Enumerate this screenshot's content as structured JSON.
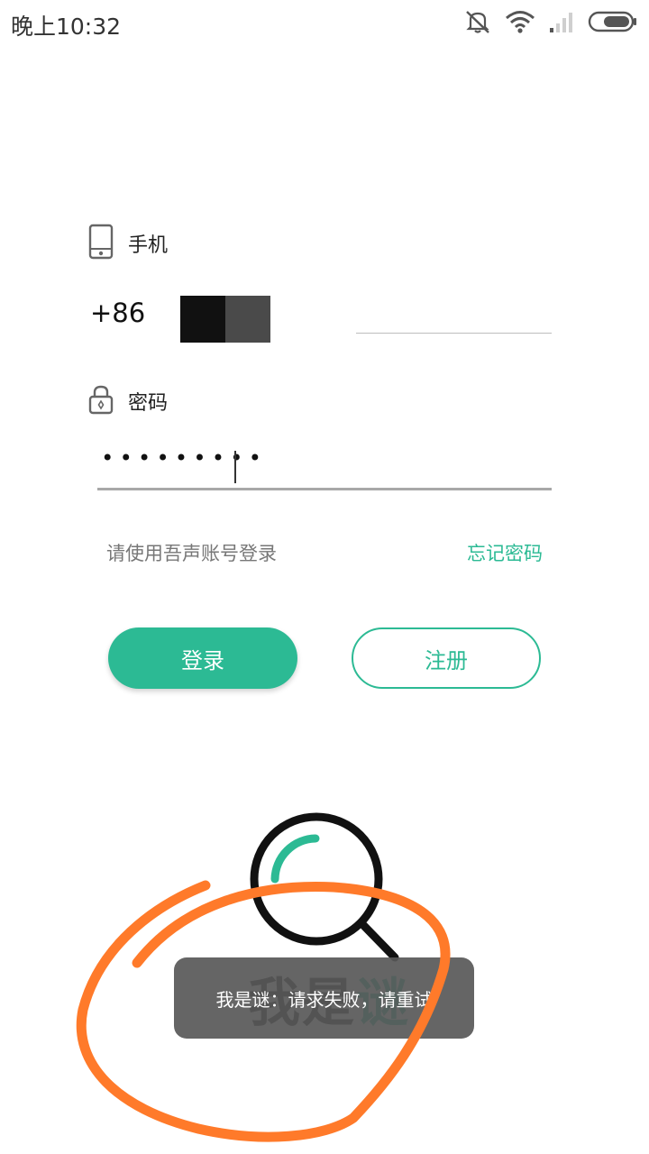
{
  "status_bar": {
    "time": "晚上10:32",
    "icons": [
      "mute-icon",
      "wifi-icon",
      "signal-icon",
      "battery-icon"
    ]
  },
  "login_form": {
    "phone_label": "手机",
    "country_code": "+86",
    "password_label": "密码",
    "password_value": "•••••••••",
    "hint": "请使用吾声账号登录",
    "forgot_password": "忘记密码",
    "login_button": "登录",
    "register_button": "注册"
  },
  "logo": {
    "text_main": "我是",
    "text_accent": "谜"
  },
  "toast": {
    "message": "我是谜：请求失败，请重试"
  },
  "colors": {
    "accent": "#2cba94",
    "annotation": "#ff7a2a",
    "toast_bg": "#585858"
  }
}
